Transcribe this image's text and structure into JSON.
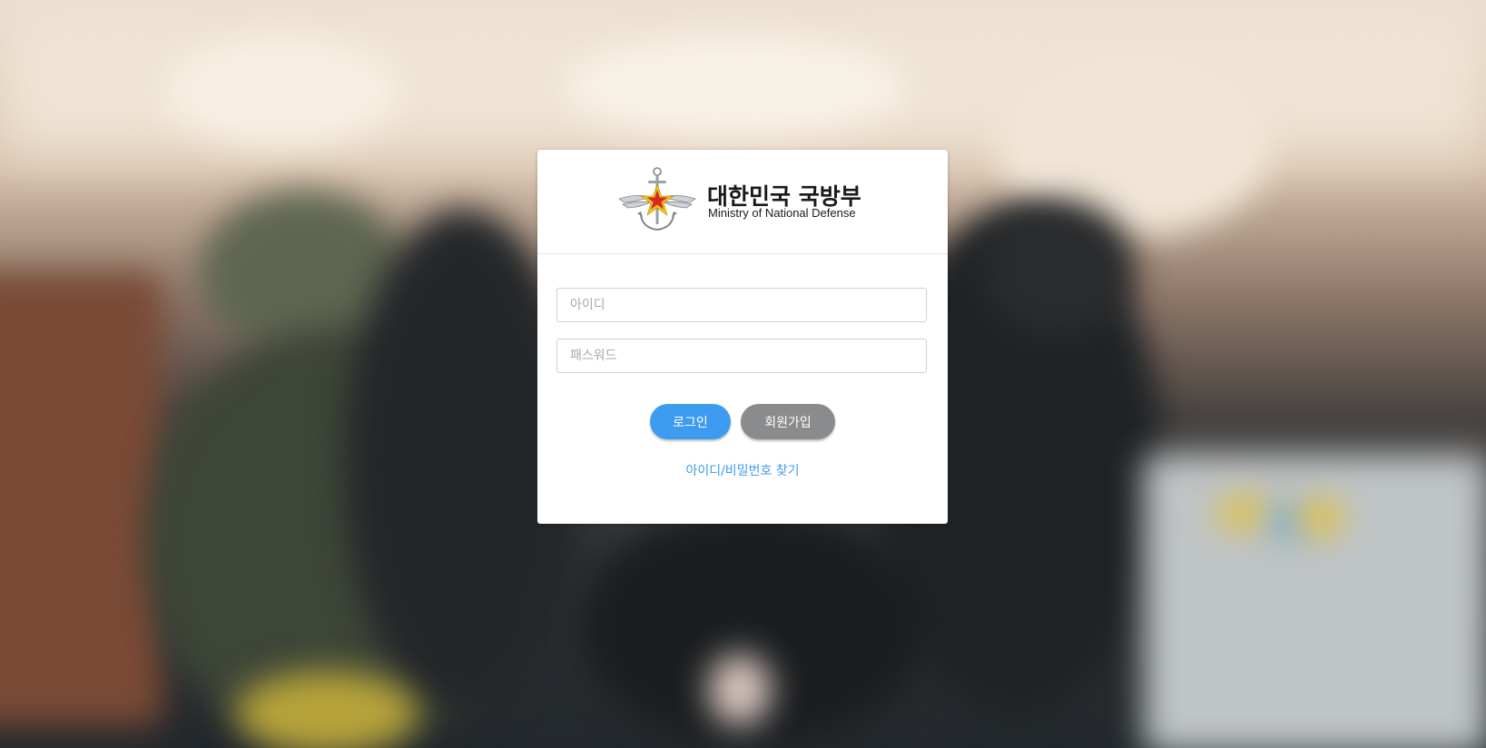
{
  "brand": {
    "name_ko": "대한민국 국방부",
    "name_en": "Ministry of National Defense"
  },
  "login_form": {
    "id_placeholder": "아이디",
    "id_value": "",
    "password_placeholder": "패스워드",
    "password_value": "",
    "login_label": "로그인",
    "signup_label": "회원가입",
    "find_account_label": "아이디/비밀번호 찾기"
  },
  "colors": {
    "primary": "#3d9cf0",
    "secondary": "#8a8b8d",
    "card_bg": "#ffffff"
  },
  "icons": {
    "emblem": "anchor-star-wings-emblem-icon"
  }
}
